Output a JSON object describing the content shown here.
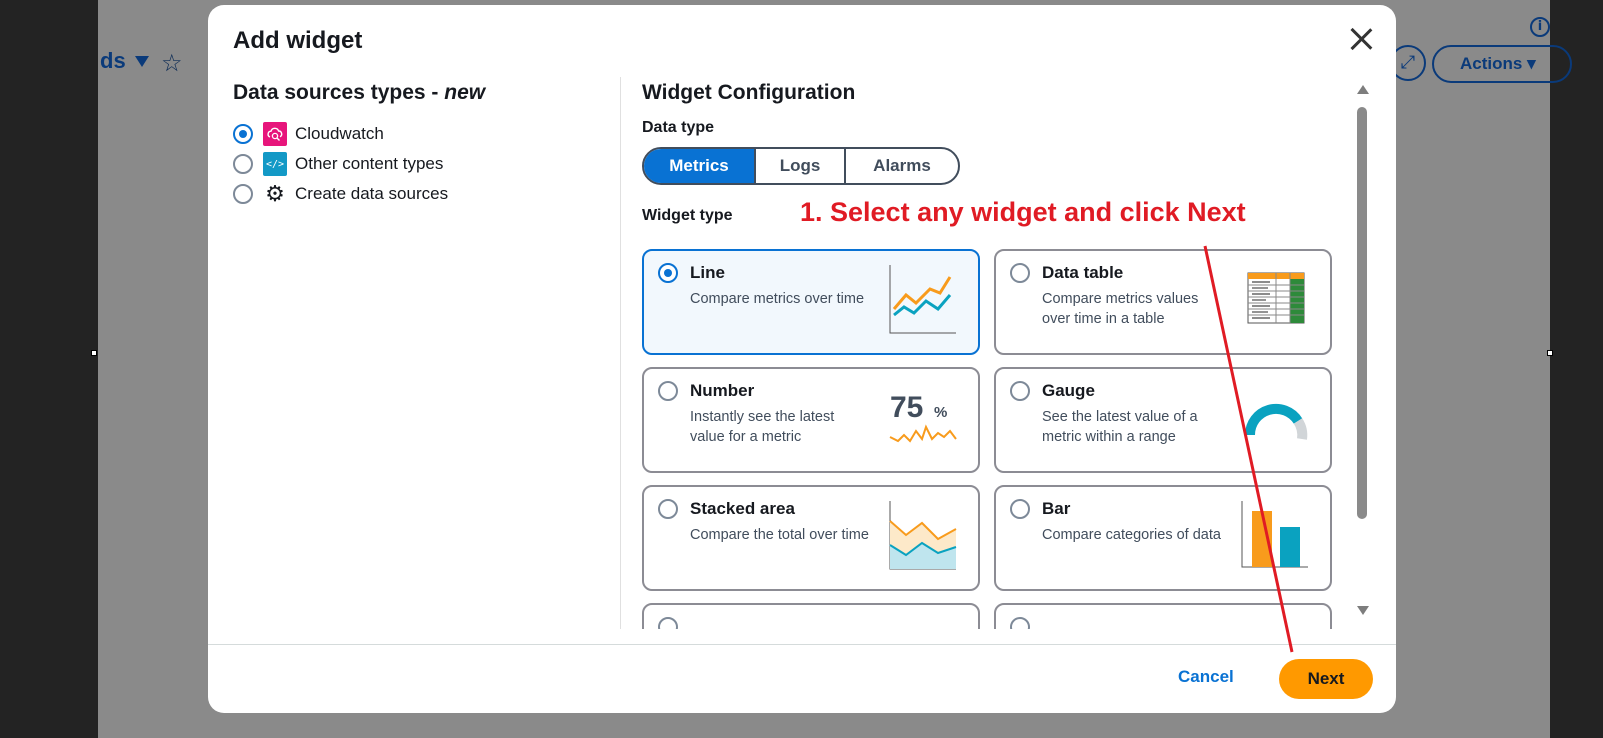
{
  "background": {
    "title": "ds",
    "actions_label": "Actions",
    "info_label": "i"
  },
  "modal": {
    "title": "Add widget",
    "data_sources": {
      "heading": "Data sources types - ",
      "heading_em": "new",
      "items": [
        {
          "label": "Cloudwatch",
          "icon": "cloudwatch-icon",
          "selected": true
        },
        {
          "label": "Other content types",
          "icon": "code-icon",
          "selected": false
        },
        {
          "label": "Create data sources",
          "icon": "gear-icon",
          "selected": false
        }
      ]
    },
    "config": {
      "heading": "Widget Configuration",
      "data_type_label": "Data type",
      "data_types": [
        "Metrics",
        "Logs",
        "Alarms"
      ],
      "active_data_type": "Metrics",
      "widget_type_label": "Widget type",
      "widgets": [
        {
          "title": "Line",
          "desc": "Compare metrics over time",
          "selected": true
        },
        {
          "title": "Data table",
          "desc": "Compare metrics values over time in a table",
          "selected": false
        },
        {
          "title": "Number",
          "desc": "Instantly see the latest value for a metric",
          "selected": false
        },
        {
          "title": "Gauge",
          "desc": "See the latest value of a metric within a range",
          "selected": false
        },
        {
          "title": "Stacked area",
          "desc": "Compare the total over time",
          "selected": false
        },
        {
          "title": "Bar",
          "desc": "Compare categories of data",
          "selected": false
        }
      ],
      "number_art_value": "75",
      "number_art_unit": "%"
    },
    "footer": {
      "cancel_label": "Cancel",
      "next_label": "Next"
    }
  },
  "annotation": {
    "text": "1. Select any widget and click Next",
    "color": "#e01b24"
  },
  "colors": {
    "primary": "#0972d3",
    "next_button": "#ff9900",
    "chart_orange": "#f89b1c",
    "chart_teal": "#0aa2c0",
    "table_green": "#2e8a3a"
  }
}
